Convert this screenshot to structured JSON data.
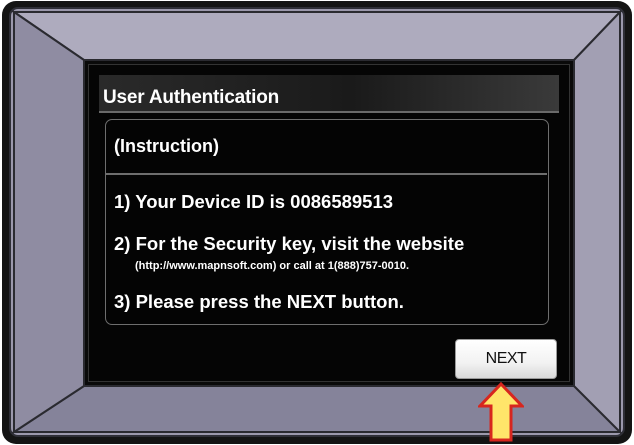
{
  "dialog": {
    "title": "User Authentication",
    "heading": "(Instruction)",
    "step1": "1) Your Device ID is 0086589513",
    "step2": "2) For the Security key, visit the website",
    "step2_detail": "(http://www.mapnsoft.com) or call at 1(888)757-0010.",
    "step3": "3) Please press the NEXT button.",
    "next_label": "NEXT"
  },
  "colors": {
    "bezel_face": "#9b98ac",
    "bezel_outer": "#141414",
    "screen_background": "#050505",
    "arrow_fill": "#ffe56a",
    "arrow_outline": "#d7261e"
  },
  "icons": {
    "pointer": "up-arrow-icon"
  }
}
